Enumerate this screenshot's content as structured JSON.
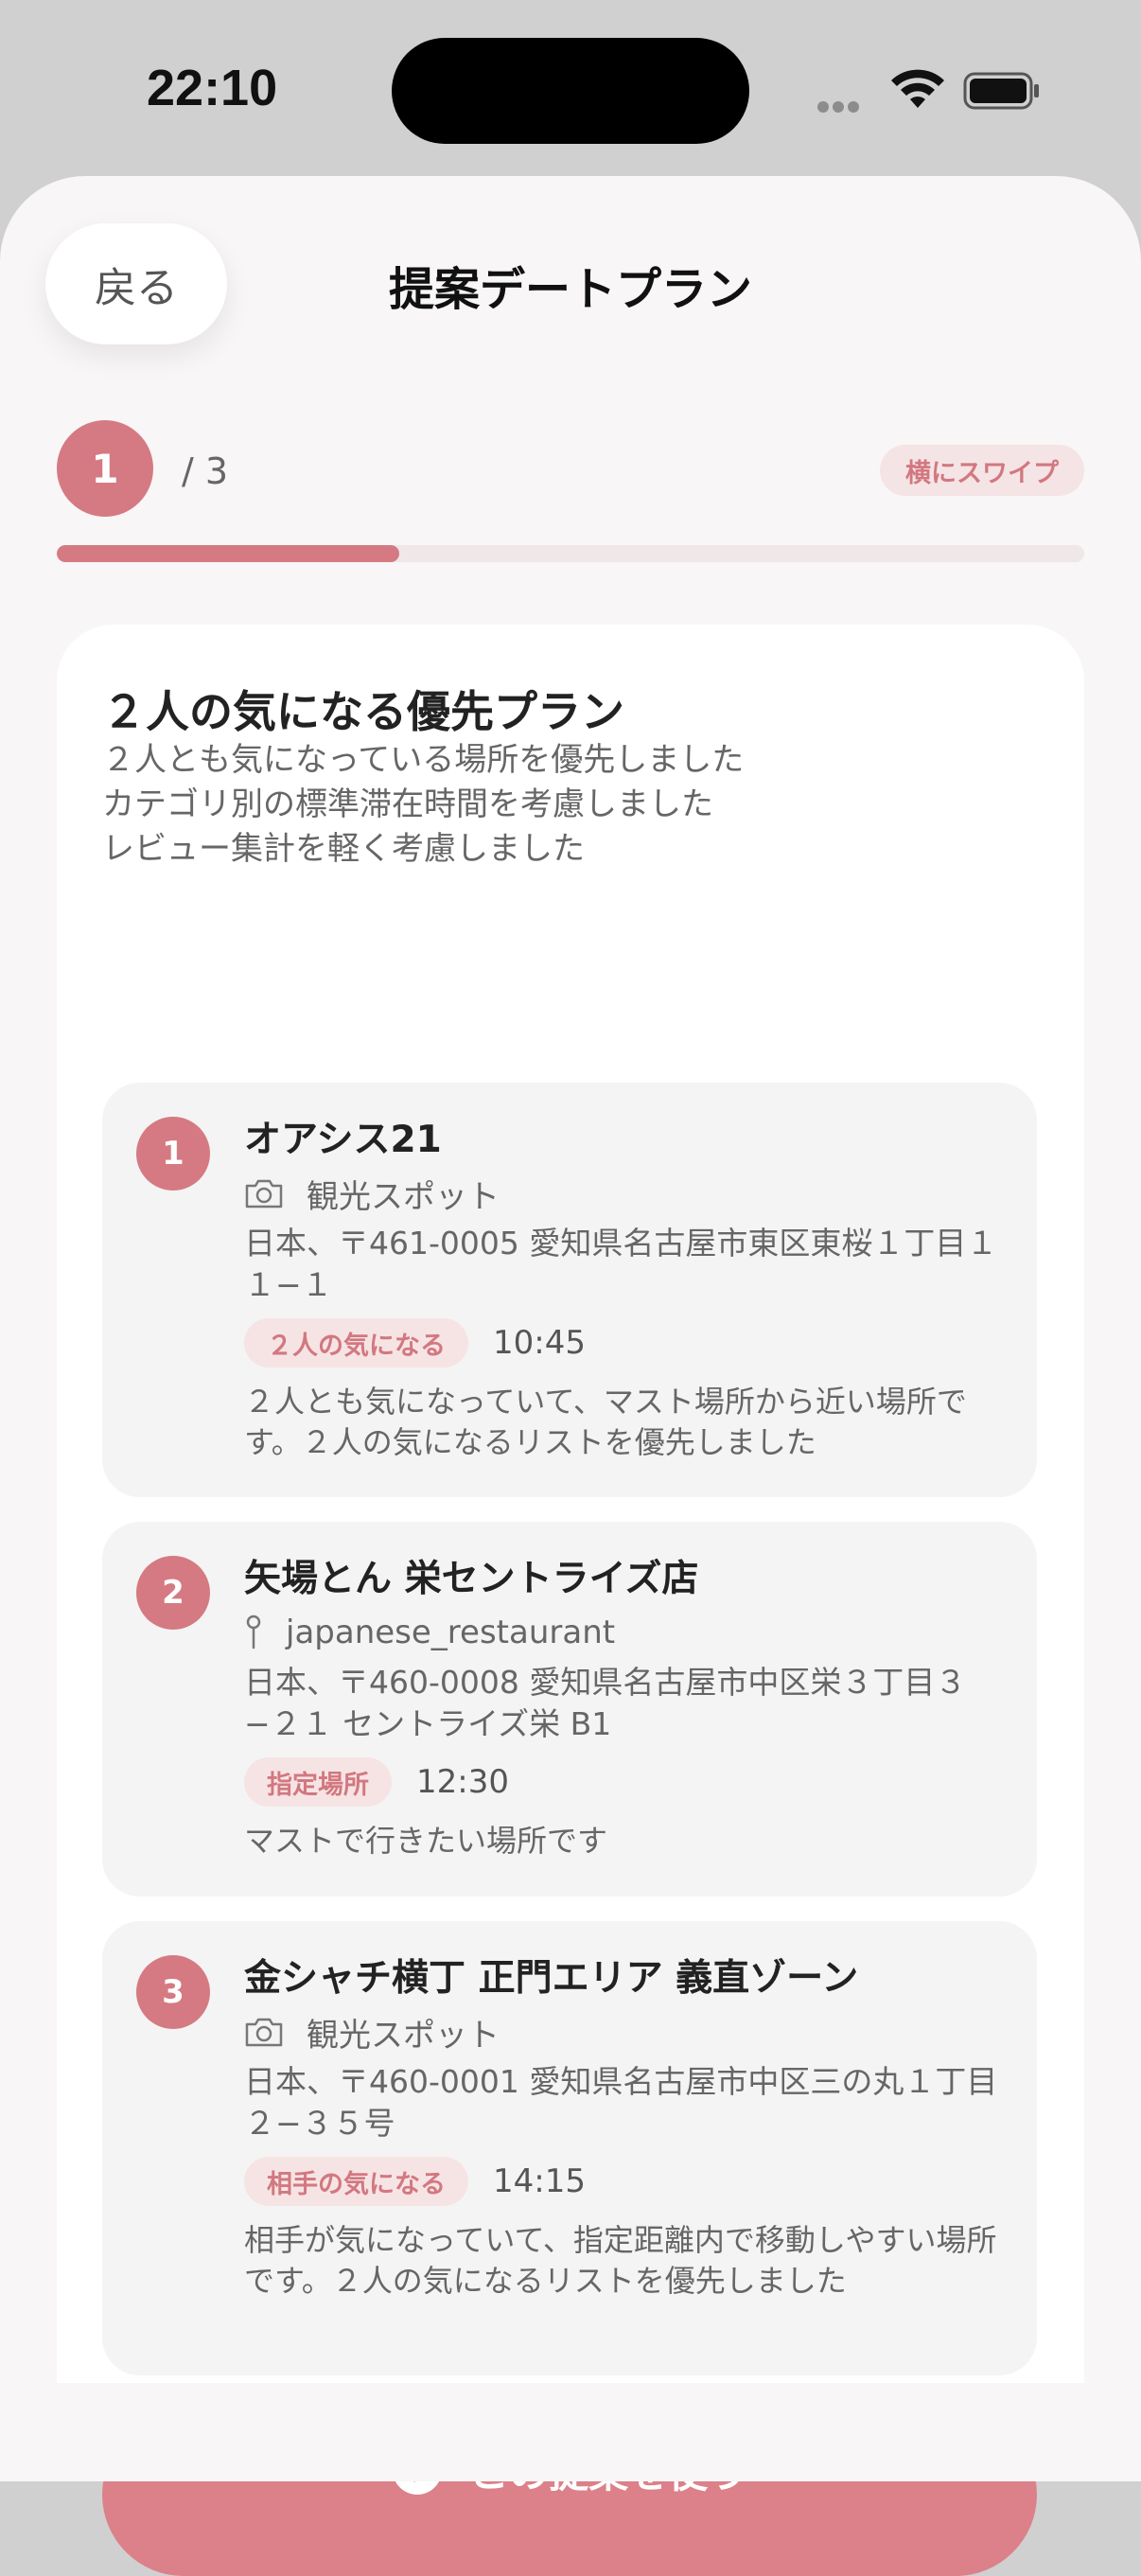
{
  "status": {
    "time": "22:10"
  },
  "header": {
    "back_label": "戻る",
    "title": "提案デートプラン"
  },
  "pager": {
    "current": "1",
    "total": "/ 3",
    "swipe_hint": "横にスワイプ",
    "progress": 0.333
  },
  "plan": {
    "title": "２人の気になる優先プラン",
    "description": [
      "２人とも気になっている場所を優先しました",
      "カテゴリ別の標準滞在時間を考慮しました",
      "レビュー集計を軽く考慮しました"
    ],
    "spots": [
      {
        "number": "1",
        "name": "オアシス21",
        "category_icon": "camera-icon",
        "category": "観光スポット",
        "address": "日本、〒461-0005 愛知県名古屋市東区東桜１丁目１１−１",
        "badge": "２人の気になる",
        "time": "10:45",
        "note": "２人とも気になっていて、マスト場所から近い場所です。２人の気になるリストを優先しました"
      },
      {
        "number": "2",
        "name": "矢場とん 栄セントライズ店",
        "category_icon": "pin-icon",
        "category": "japanese_restaurant",
        "address": "日本、〒460-0008 愛知県名古屋市中区栄３丁目３−２１ セントライズ栄 B1",
        "badge": "指定場所",
        "time": "12:30",
        "note": "マストで行きたい場所です"
      },
      {
        "number": "3",
        "name": "金シャチ横丁 正門エリア 義直ゾーン",
        "category_icon": "camera-icon",
        "category": "観光スポット",
        "address": "日本、〒460-0001 愛知県名古屋市中区三の丸１丁目２−３５号",
        "badge": "相手の気になる",
        "time": "14:15",
        "note": "相手が気になっていて、指定距離内で移動しやすい場所です。２人の気になるリストを優先しました"
      }
    ],
    "use_button_label": "この提案を使う"
  },
  "colors": {
    "accent": "#d57a82",
    "badge_bg": "#f6e4e5",
    "sheet_bg": "#f8f6f6"
  }
}
